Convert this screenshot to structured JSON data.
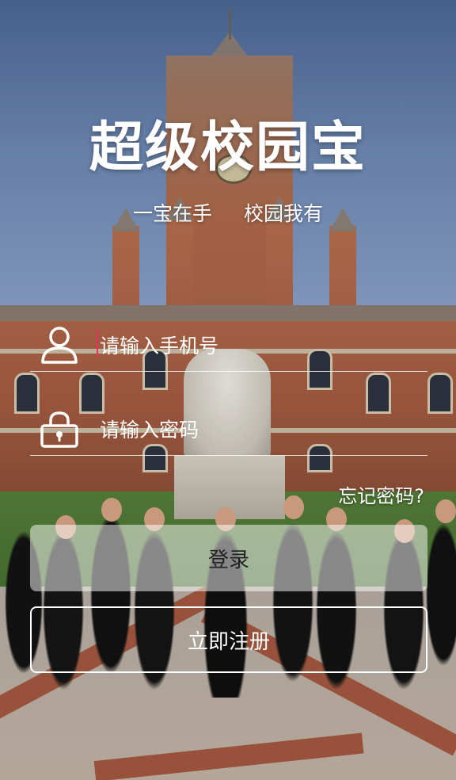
{
  "app": {
    "title": "超级校园宝",
    "slogan_left": "一宝在手",
    "slogan_right": "校园我有"
  },
  "login_form": {
    "phone_placeholder": "请输入手机号",
    "phone_icon": "user-icon",
    "password_placeholder": "请输入密码",
    "password_icon": "lock-icon",
    "forgot_password_label": "忘记密码?",
    "login_button_label": "登录",
    "register_button_label": "立即注册"
  },
  "colors": {
    "text": "#ffffff",
    "caret": "#e8325a",
    "login_button_bg": "rgba(255,255,255,0.5)"
  }
}
